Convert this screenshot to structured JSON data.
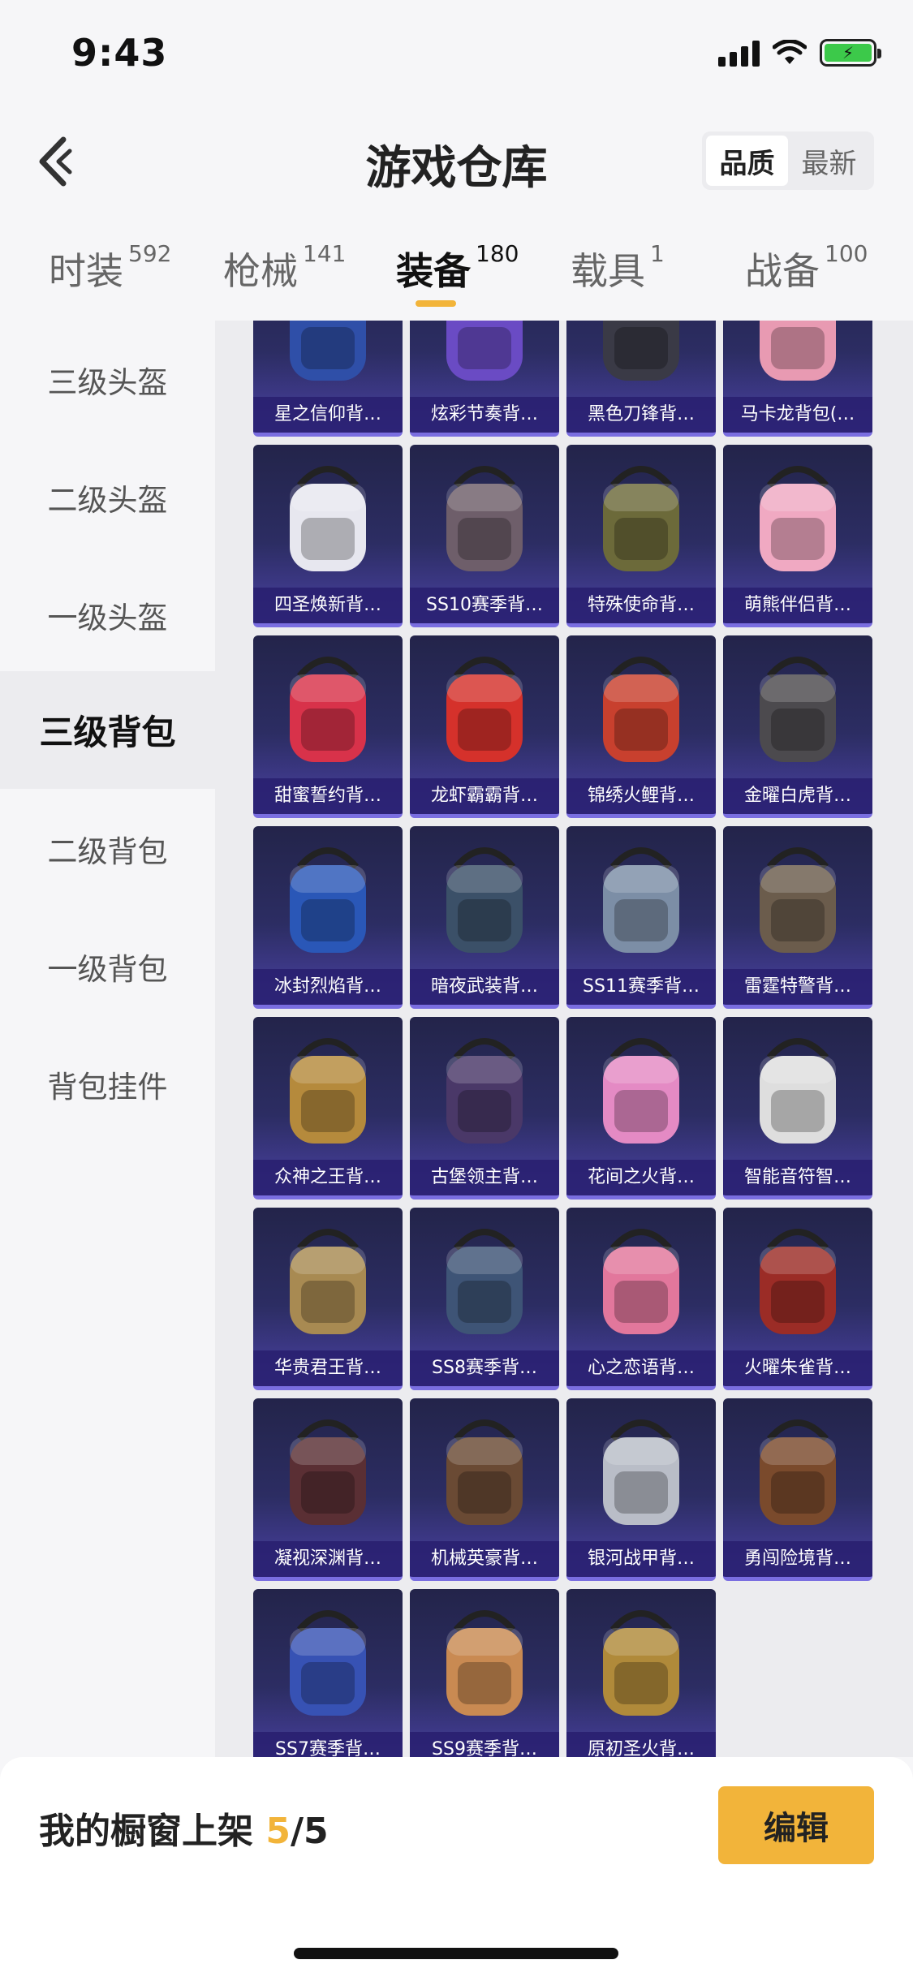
{
  "status_bar": {
    "time": "9:43"
  },
  "header": {
    "title": "游戏仓库",
    "sort_options": [
      "品质",
      "最新"
    ],
    "active_sort": "品质"
  },
  "tabs": [
    {
      "label": "时装",
      "count": "592"
    },
    {
      "label": "枪械",
      "count": "141"
    },
    {
      "label": "装备",
      "count": "180"
    },
    {
      "label": "载具",
      "count": "1"
    },
    {
      "label": "战备",
      "count": "100"
    }
  ],
  "active_tab": "装备",
  "sidebar": {
    "items": [
      "三级头盔",
      "二级头盔",
      "一级头盔",
      "三级背包",
      "二级背包",
      "一级背包",
      "背包挂件"
    ],
    "active": "三级背包"
  },
  "items": [
    {
      "name": "星之信仰背…",
      "icon": "helmet-icon",
      "color": "#2f4fa8"
    },
    {
      "name": "炫彩节奏背…",
      "icon": "backpack-icon",
      "color": "#6a4bc4"
    },
    {
      "name": "黑色刀锋背…",
      "icon": "backpack-icon",
      "color": "#3a3a46"
    },
    {
      "name": "马卡龙背包(…",
      "icon": "backpack-icon",
      "color": "#e89ab2"
    },
    {
      "name": "四圣焕新背…",
      "icon": "mask-icon",
      "color": "#e7e7ef"
    },
    {
      "name": "SS10赛季背…",
      "icon": "backpack-icon",
      "color": "#6e5e6a"
    },
    {
      "name": "特殊使命背…",
      "icon": "backpack-icon",
      "color": "#6c6a3a"
    },
    {
      "name": "萌熊伴侣背…",
      "icon": "bear-icon",
      "color": "#f0a9c2"
    },
    {
      "name": "甜蜜誓约背…",
      "icon": "heart-icon",
      "color": "#d8324a"
    },
    {
      "name": "龙虾霸霸背…",
      "icon": "lobster-icon",
      "color": "#d5312b"
    },
    {
      "name": "锦绣火鲤背…",
      "icon": "backpack-icon",
      "color": "#c8402e"
    },
    {
      "name": "金曜白虎背…",
      "icon": "backpack-icon",
      "color": "#4c4a4e"
    },
    {
      "name": "冰封烈焰背…",
      "icon": "backpack-icon",
      "color": "#2a57b7"
    },
    {
      "name": "暗夜武装背…",
      "icon": "backpack-icon",
      "color": "#3b5068"
    },
    {
      "name": "SS11赛季背…",
      "icon": "backpack-icon",
      "color": "#7c8ea6"
    },
    {
      "name": "雷霆特警背…",
      "icon": "backpack-icon",
      "color": "#6b5c4c"
    },
    {
      "name": "众神之王背…",
      "icon": "helmet-icon",
      "color": "#b58a3c"
    },
    {
      "name": "古堡领主背…",
      "icon": "backpack-icon",
      "color": "#4a3868"
    },
    {
      "name": "花间之火背…",
      "icon": "backpack-icon",
      "color": "#e48ac4"
    },
    {
      "name": "智能音符智…",
      "icon": "backpack-icon",
      "color": "#dedede"
    },
    {
      "name": "华贵君王背…",
      "icon": "backpack-icon",
      "color": "#a88a52"
    },
    {
      "name": "SS8赛季背…",
      "icon": "backpack-icon",
      "color": "#3e5476"
    },
    {
      "name": "心之恋语背…",
      "icon": "star-icon",
      "color": "#e2779c"
    },
    {
      "name": "火曜朱雀背…",
      "icon": "backpack-icon",
      "color": "#9b2c26"
    },
    {
      "name": "凝视深渊背…",
      "icon": "backpack-icon",
      "color": "#5a2f34"
    },
    {
      "name": "机械英豪背…",
      "icon": "backpack-icon",
      "color": "#6a4a34"
    },
    {
      "name": "银河战甲背…",
      "icon": "backpack-icon",
      "color": "#b9bdc7"
    },
    {
      "name": "勇闯险境背…",
      "icon": "backpack-icon",
      "color": "#7a4a2c"
    },
    {
      "name": "SS7赛季背…",
      "icon": "backpack-icon",
      "color": "#3752b4"
    },
    {
      "name": "SS9赛季背…",
      "icon": "backpack-icon",
      "color": "#c98a52"
    },
    {
      "name": "原初圣火背…",
      "icon": "backpack-icon",
      "color": "#b08a3a"
    }
  ],
  "bottom": {
    "shelf_label": "我的橱窗上架 ",
    "shelf_current": "5",
    "shelf_total": "/5",
    "edit_label": "编辑"
  },
  "colors": {
    "accent": "#f2b43a",
    "card_bg": "#2c2d63"
  }
}
